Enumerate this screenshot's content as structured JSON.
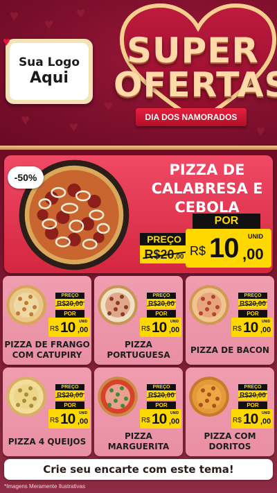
{
  "header": {
    "logo_line1": "Sua Logo",
    "logo_line2": "Aqui",
    "title_top": "SUPER",
    "title_bottom": "OFERTAS",
    "ribbon": "DIA DOS NAMORADOS"
  },
  "featured": {
    "discount": "-50%",
    "name_lines": [
      "PIZZA DE",
      "CALABRESA E",
      "CEBOLA"
    ],
    "preco_label": "PREÇO",
    "old_price_int": "R$20",
    "old_price_dec": ",00",
    "por_label": "POR",
    "currency": "R$",
    "new_price_int": "10",
    "new_price_dec": ",00",
    "unit": "UNID"
  },
  "cards": [
    {
      "name_lines": [
        "PIZZA DE FRANGO",
        "COM CATUPIRY"
      ],
      "preco_label": "PREÇO",
      "old_price": "R$20,00",
      "por_label": "POR",
      "currency": "R$",
      "price_int": "10",
      "price_dec": ",00",
      "unit": "UNID"
    },
    {
      "name_lines": [
        "PIZZA",
        "PORTUGUESA"
      ],
      "preco_label": "PREÇO",
      "old_price": "R$20,00",
      "por_label": "POR",
      "currency": "R$",
      "price_int": "10",
      "price_dec": ",00",
      "unit": "UNID"
    },
    {
      "name_lines": [
        "PIZZA DE BACON"
      ],
      "preco_label": "PREÇO",
      "old_price": "R$20,00",
      "por_label": "POR",
      "currency": "R$",
      "price_int": "10",
      "price_dec": ",00",
      "unit": "UNID"
    },
    {
      "name_lines": [
        "PIZZA 4 QUEIJOS"
      ],
      "preco_label": "PREÇO",
      "old_price": "R$20,00",
      "por_label": "POR",
      "currency": "R$",
      "price_int": "10",
      "price_dec": ",00",
      "unit": "UNID"
    },
    {
      "name_lines": [
        "PIZZA",
        "MARGUERITA"
      ],
      "preco_label": "PREÇO",
      "old_price": "R$20,00",
      "por_label": "POR",
      "currency": "R$",
      "price_int": "10",
      "price_dec": ",00",
      "unit": "UNID"
    },
    {
      "name_lines": [
        "PIZZA COM",
        "DORITOS"
      ],
      "preco_label": "PREÇO",
      "old_price": "R$20,00",
      "por_label": "POR",
      "currency": "R$",
      "price_int": "10",
      "price_dec": ",00",
      "unit": "UNID"
    }
  ],
  "footer": {
    "cta": "Crie seu encarte com este tema!",
    "disclaimer": "*Imagens Meramente Ilustrativas"
  },
  "colors": {
    "background": "#7a0f2a",
    "featured_panel": "#e0324d",
    "card": "#ee95a9",
    "price_yellow": "#ffd800",
    "label_black": "#111111",
    "title_gold": "#ffd9a8"
  },
  "icons": {
    "bg_decor": "heart-icon",
    "logo_corner": "heart-icon"
  }
}
